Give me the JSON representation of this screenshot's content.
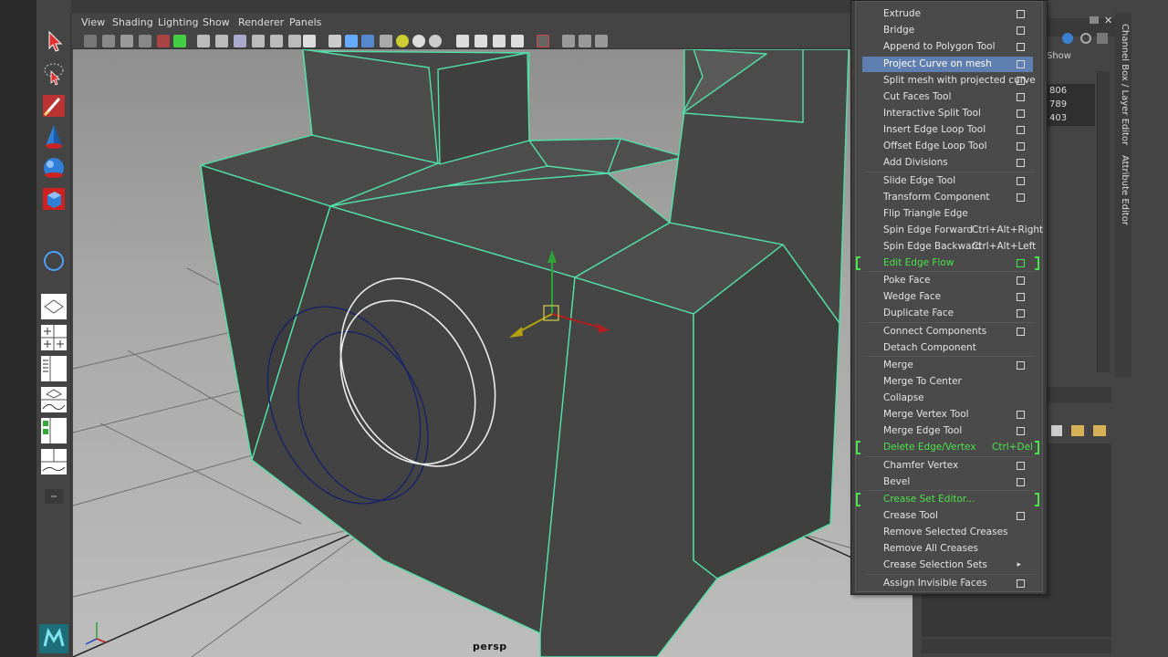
{
  "panel_menu": [
    "View",
    "Shading",
    "Lighting",
    "Show",
    "Renderer",
    "Panels"
  ],
  "viewport": {
    "camera_label": "persp"
  },
  "channel_box": {
    "tab_label": "Channel Box / Layer Editor",
    "attr_tab_label": "Attribute Editor",
    "show_label": "Show",
    "values": [
      "806",
      "789",
      "403"
    ]
  },
  "marking_menu": {
    "items": [
      {
        "label": "Extrude",
        "option": true
      },
      {
        "label": "Bridge",
        "option": true
      },
      {
        "label": "Append to Polygon Tool",
        "option": true
      },
      {
        "label": "Project Curve on mesh",
        "option": true,
        "highlight": true
      },
      {
        "label": "Split mesh with projected curve",
        "option": true
      },
      {
        "label": "Cut Faces Tool",
        "option": true
      },
      {
        "label": "Interactive Split Tool",
        "option": true
      },
      {
        "label": "Insert Edge Loop Tool",
        "option": true
      },
      {
        "label": "Offset Edge Loop Tool",
        "option": true
      },
      {
        "label": "Add Divisions",
        "option": true
      },
      {
        "label": "Slide Edge Tool",
        "option": true,
        "sep_before": true
      },
      {
        "label": "Transform Component",
        "option": true
      },
      {
        "label": "Flip Triangle Edge",
        "option": false
      },
      {
        "label": "Spin Edge Forward",
        "shortcut": "Ctrl+Alt+Right",
        "option": false
      },
      {
        "label": "Spin Edge Backward",
        "shortcut": "Ctrl+Alt+Left",
        "option": false
      },
      {
        "label": "Edit Edge Flow",
        "option": true,
        "green": true
      },
      {
        "label": "Poke Face",
        "option": true,
        "sep_before": true
      },
      {
        "label": "Wedge Face",
        "option": true
      },
      {
        "label": "Duplicate Face",
        "option": true
      },
      {
        "label": "Connect Components",
        "option": true,
        "sep_before": true
      },
      {
        "label": "Detach Component",
        "option": false
      },
      {
        "label": "Merge",
        "option": true,
        "sep_before": true
      },
      {
        "label": "Merge To Center",
        "option": false
      },
      {
        "label": "Collapse",
        "option": false
      },
      {
        "label": "Merge Vertex Tool",
        "option": true
      },
      {
        "label": "Merge Edge Tool",
        "option": true
      },
      {
        "label": "Delete Edge/Vertex",
        "shortcut": "Ctrl+Del",
        "option": false,
        "green": true
      },
      {
        "label": "Chamfer Vertex",
        "option": true,
        "sep_before": true
      },
      {
        "label": "Bevel",
        "option": true
      },
      {
        "label": "Crease Set Editor...",
        "option": false,
        "green": true,
        "sep_before": true
      },
      {
        "label": "Crease Tool",
        "option": true
      },
      {
        "label": "Remove Selected Creases",
        "option": false
      },
      {
        "label": "Remove All Creases",
        "option": false
      },
      {
        "label": "Crease Selection Sets",
        "option": false,
        "submenu": true
      },
      {
        "label": "Assign Invisible Faces",
        "option": true,
        "sep_before": true
      }
    ]
  },
  "colors": {
    "highlight": "#5f7fb0",
    "green_item": "#4ce34c",
    "wire": "#52e0a8"
  }
}
